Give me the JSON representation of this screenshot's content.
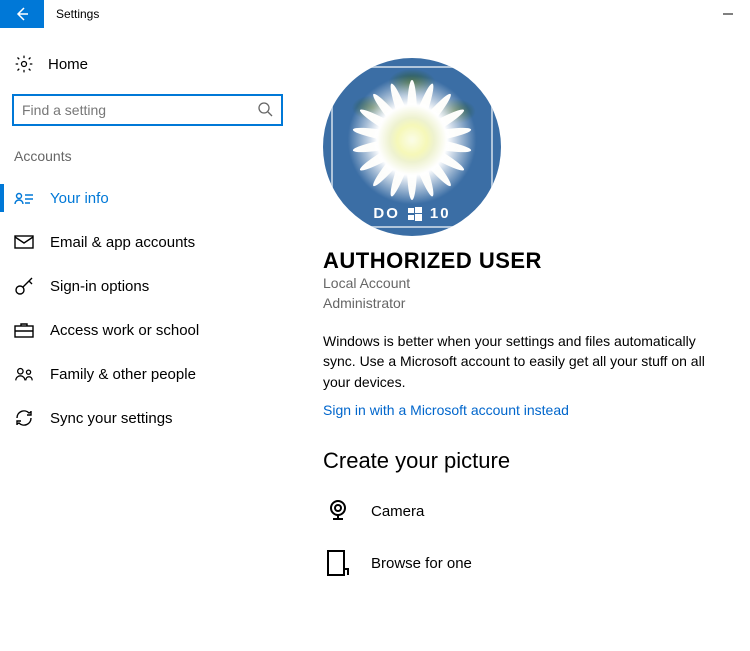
{
  "titlebar": {
    "title": "Settings"
  },
  "sidebar": {
    "home_label": "Home",
    "search_placeholder": "Find a setting",
    "section": "Accounts",
    "items": [
      {
        "label": "Your info",
        "active": true
      },
      {
        "label": "Email & app accounts",
        "active": false
      },
      {
        "label": "Sign-in options",
        "active": false
      },
      {
        "label": "Access work or school",
        "active": false
      },
      {
        "label": "Family & other people",
        "active": false
      },
      {
        "label": "Sync your settings",
        "active": false
      }
    ]
  },
  "main": {
    "avatar_band_left": "DO",
    "avatar_band_right": "10",
    "username": "AUTHORIZED USER",
    "account_type": "Local Account",
    "account_role": "Administrator",
    "sync_text": "Windows is better when your settings and files automatically sync. Use a Microsoft account to easily get all your stuff on all your devices.",
    "ms_link": "Sign in with a Microsoft account instead",
    "create_heading": "Create your picture",
    "camera_label": "Camera",
    "browse_label": "Browse for one"
  }
}
